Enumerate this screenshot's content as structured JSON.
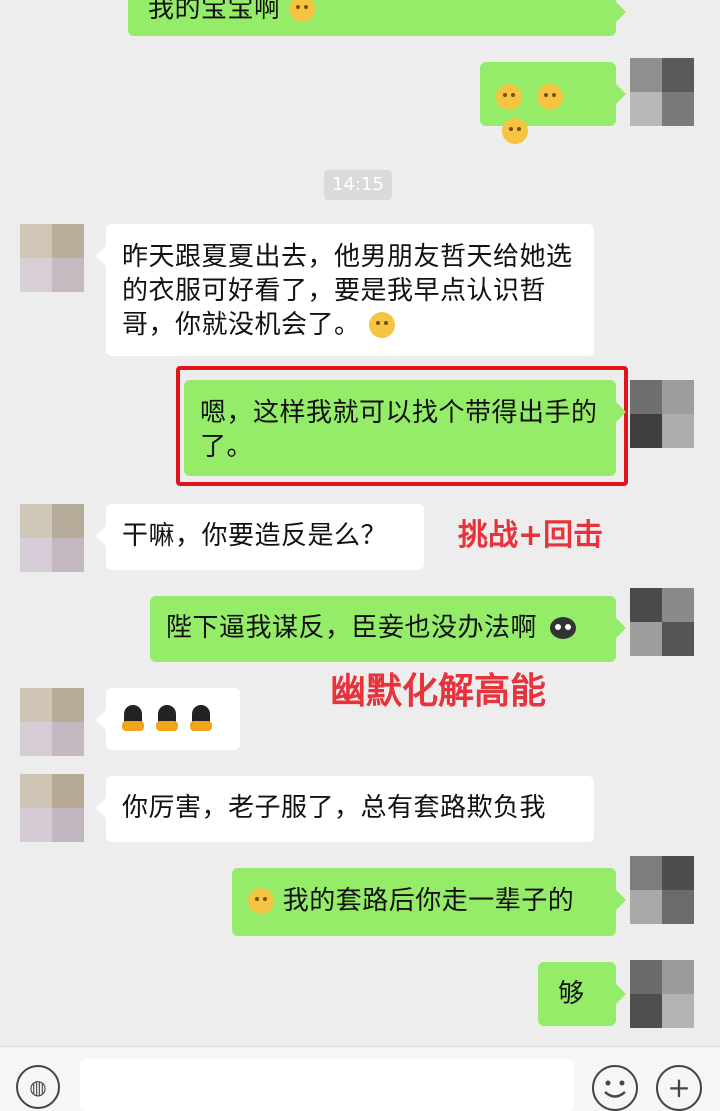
{
  "chat": {
    "timestamp": "14:15",
    "messages": [
      {
        "side": "out",
        "text": "我的宝宝啊"
      },
      {
        "side": "out",
        "text": ""
      },
      {
        "side": "in",
        "text": "昨天跟夏夏出去，他男朋友哲天给她选的衣服可好看了，要是我早点认识哲哥，你就没机会了。"
      },
      {
        "side": "out",
        "text": "嗯，这样我就可以找个带得出手的了。"
      },
      {
        "side": "in",
        "text": "干嘛，你要造反是么？"
      },
      {
        "side": "out",
        "text": "陛下逼我谋反，臣妾也没办法啊"
      },
      {
        "side": "in",
        "text": ""
      },
      {
        "side": "in",
        "text": "你厉害，老子服了，总有套路欺负我"
      },
      {
        "side": "out",
        "text": "我的套路后你走一辈子的"
      },
      {
        "side": "out",
        "text": "够"
      }
    ]
  },
  "annotations": {
    "challenge": "挑战+回击",
    "humor": "幽默化解高能"
  },
  "colors": {
    "outgoing_bubble": "#95ec69",
    "incoming_bubble": "#ffffff",
    "annotation": "#e8323c",
    "highlight_border": "#e2141b"
  },
  "icons": [
    "emoji-icon",
    "penguin-icon",
    "skull-icon",
    "voice-icon",
    "sticker-icon",
    "plus-icon"
  ],
  "toolbar": {
    "plus_label": "+",
    "voice_label": "◍"
  }
}
